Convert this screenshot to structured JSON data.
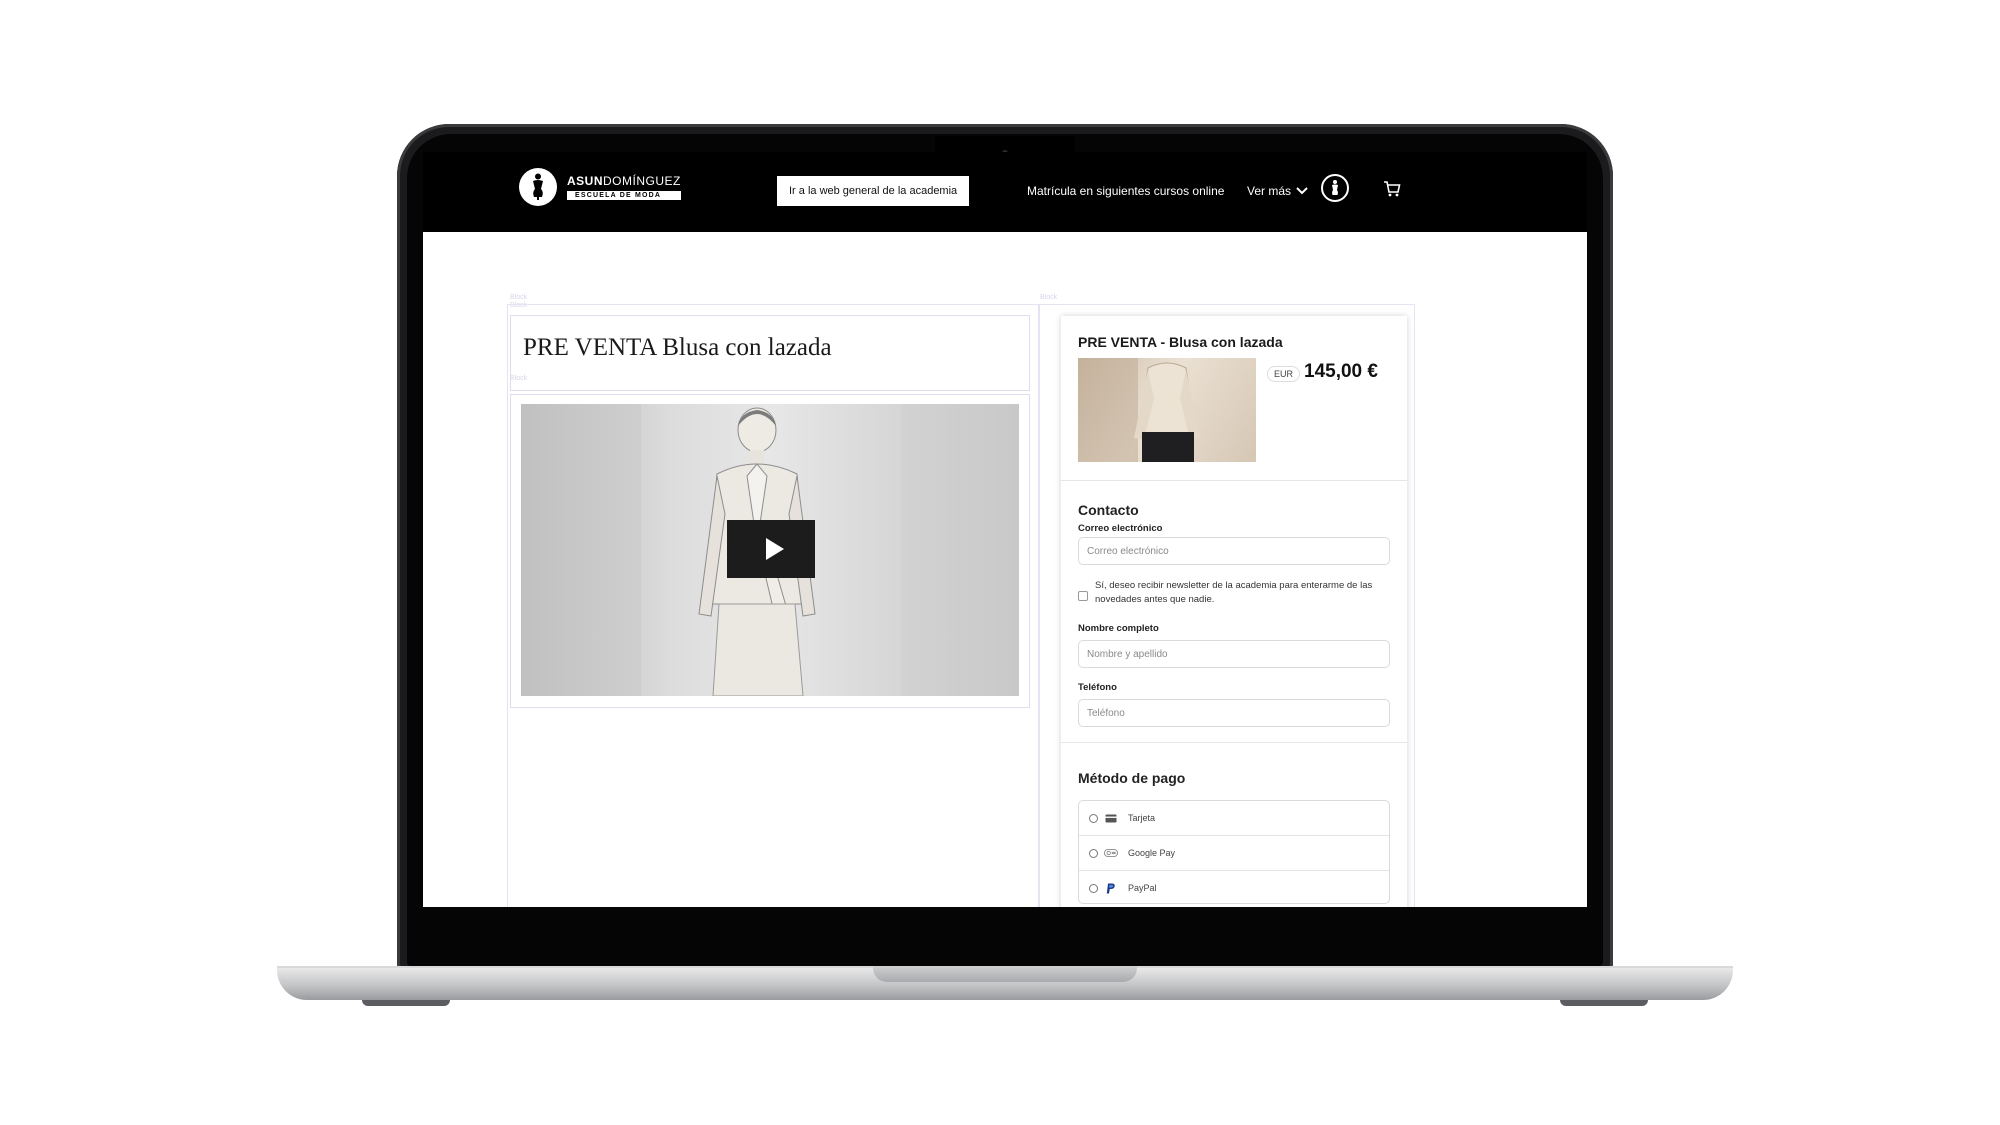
{
  "header": {
    "logo_name_bold": "ASUN",
    "logo_name_light": "DOMÍNGUEZ",
    "logo_tagline": "ESCUELA DE MODA",
    "general_site_button": "Ir a la web general de la academia",
    "courses_link": "Matrícula en siguientes cursos online",
    "more_menu": "Ver más"
  },
  "markers": {
    "block": "Block"
  },
  "product": {
    "page_title": "PRE VENTA Blusa con lazada",
    "summary_title": "PRE VENTA - Blusa con lazada",
    "currency": "EUR",
    "price": "145,00 €"
  },
  "contact": {
    "heading": "Contacto",
    "email_label": "Correo electrónico",
    "email_placeholder": "Correo electrónico",
    "newsletter_text": "Sí, deseo recibir newsletter de la academia para enterarme de las novedades antes que nadie.",
    "name_label": "Nombre completo",
    "name_placeholder": "Nombre y apellido",
    "phone_label": "Teléfono",
    "phone_placeholder": "Teléfono"
  },
  "payment": {
    "heading": "Método de pago",
    "methods": [
      {
        "label": "Tarjeta",
        "icon": "credit-card-icon"
      },
      {
        "label": "Google Pay",
        "icon": "google-pay-icon"
      },
      {
        "label": "PayPal",
        "icon": "paypal-icon"
      }
    ]
  },
  "colors": {
    "topbar": "#000000",
    "guide": "#dedcf0",
    "accent": "#111111"
  }
}
